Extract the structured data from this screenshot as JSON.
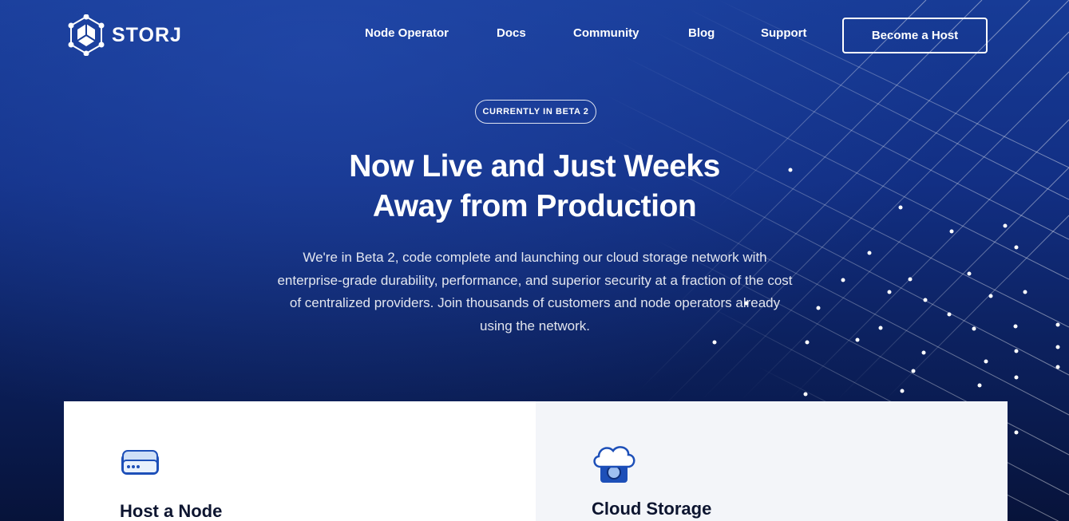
{
  "brand": {
    "name": "STORJ",
    "logo_icon": "storj-logo-icon"
  },
  "nav": {
    "links": [
      "Node Operator",
      "Docs",
      "Community",
      "Blog",
      "Support"
    ],
    "cta": "Become a Host"
  },
  "hero": {
    "badge": "CURRENTLY IN BETA 2",
    "headline_line1": "Now Live and Just Weeks",
    "headline_line2": "Away from Production",
    "description_lines": [
      "We're in Beta 2, code complete and launching our cloud storage network with",
      "enterprise-grade durability, performance, and superior security at a fraction of the cost",
      "of centralized providers. Join thousands of customers and node operators already",
      "using the network."
    ]
  },
  "cards": [
    {
      "title": "Host a Node",
      "icon": "server-drive-icon"
    },
    {
      "title": "Cloud Storage",
      "icon": "cloud-storage-icon"
    }
  ],
  "colors": {
    "bg_top": "#173b96",
    "bg_bottom": "#07133a",
    "accent_icon": "#1d4fb8"
  }
}
